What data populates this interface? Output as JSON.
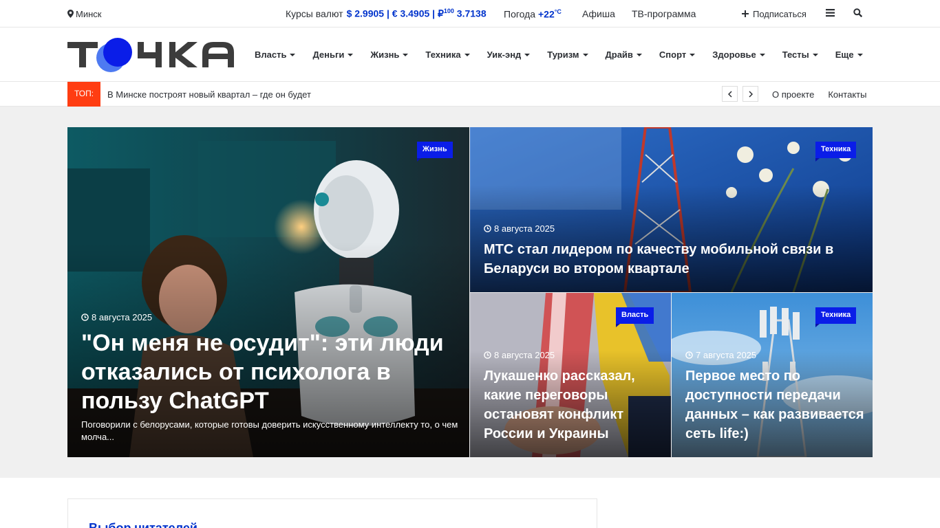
{
  "topbar": {
    "city": "Минск",
    "rates_label": "Курсы валют",
    "rates_value": "$ 2.9905 | € 3.4905 | ₽",
    "rates_sup": "100",
    "rates_rub": " 3.7138",
    "weather_label": "Погода",
    "weather_value": "+22",
    "weather_unit": "°C",
    "afisha": "Афиша",
    "tv": "ТВ-программа",
    "subscribe": "Подписаться"
  },
  "nav": {
    "items": [
      {
        "label": "Власть"
      },
      {
        "label": "Деньги"
      },
      {
        "label": "Жизнь"
      },
      {
        "label": "Техника"
      },
      {
        "label": "Уик-энд"
      },
      {
        "label": "Туризм"
      },
      {
        "label": "Драйв"
      },
      {
        "label": "Спорт"
      },
      {
        "label": "Здоровье"
      },
      {
        "label": "Тесты"
      },
      {
        "label": "Еще"
      }
    ]
  },
  "ticker": {
    "label": "ТОП:",
    "text": "В Минске построят новый квартал – где он будет",
    "links": [
      "О проекте",
      "Контакты"
    ]
  },
  "hero": {
    "main": {
      "badge": "Жизнь",
      "date": "8 августа 2025",
      "title": "\"Он меня не осудит\": эти люди отказались от психолога в пользу ChatGPT",
      "excerpt": "Поговорили с белорусами, которые готовы доверить искусственному интеллекту то, о чем молча..."
    },
    "top_right": {
      "badge": "Техника",
      "date": "8 августа 2025",
      "title": "МТС стал лидером по качеству мобильной связи в Беларуси во втором квартале"
    },
    "bottom_left": {
      "badge": "Власть",
      "date": "8 августа 2025",
      "title": "Лукашенко рассказал, какие переговоры остановят конфликт России и Украины"
    },
    "bottom_right": {
      "badge": "Техника",
      "date": "7 августа 2025",
      "title": "Первое место по доступности передачи данных – как развивается сеть life:)"
    }
  },
  "below": {
    "box_title": "Выбор читателей"
  },
  "colors": {
    "accent_blue": "#0033cc",
    "badge_blue": "#0a1de8",
    "ticker_red": "#ff3d12"
  }
}
